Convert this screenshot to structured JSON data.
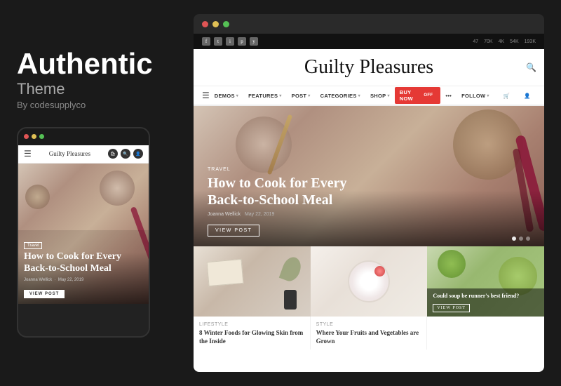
{
  "brand": {
    "title": "Authentic",
    "subtitle": "Theme",
    "author": "By codesupplyco"
  },
  "website": {
    "logo": "Guilty Pleasures",
    "social_counts": [
      {
        "platform": "fb",
        "count": "47"
      },
      {
        "platform": "tw",
        "count": "70K"
      },
      {
        "platform": "in",
        "count": "4K"
      },
      {
        "platform": "pi",
        "count": "54K"
      },
      {
        "platform": "yt",
        "count": "193K"
      }
    ],
    "nav_items": [
      {
        "label": "DEMOS",
        "has_dropdown": true
      },
      {
        "label": "FEATURES",
        "has_dropdown": true
      },
      {
        "label": "POST",
        "has_dropdown": true
      },
      {
        "label": "CATEGORIES",
        "has_dropdown": true
      },
      {
        "label": "SHOP",
        "has_dropdown": true
      },
      {
        "label": "BUY NOW",
        "has_badge": true,
        "badge": "OFF"
      },
      {
        "label": "FOLLOW",
        "has_dropdown": true
      }
    ],
    "hero": {
      "category": "Travel",
      "title": "How to Cook for Every Back-to-School Meal",
      "author": "Joanna Wellick",
      "date": "May 22, 2019",
      "cta": "VIEW POST"
    },
    "blog_cards": [
      {
        "category": "Lifestyle",
        "title": "8 Winter Foods for Glowing Skin from the Inside"
      },
      {
        "category": "Style",
        "title": "Where Your Fruits and Vegetables are Grown"
      },
      {
        "category": "",
        "title": "Could soup be runner's best friend?"
      }
    ]
  },
  "mobile": {
    "brand": "Guilty Pleasures",
    "hero": {
      "tag": "Travel",
      "title": "How to Cook for Every Back-to-School Meal",
      "author": "Joanna Wellick",
      "date": "May 22, 2019",
      "cta": "VIEW POST"
    }
  }
}
